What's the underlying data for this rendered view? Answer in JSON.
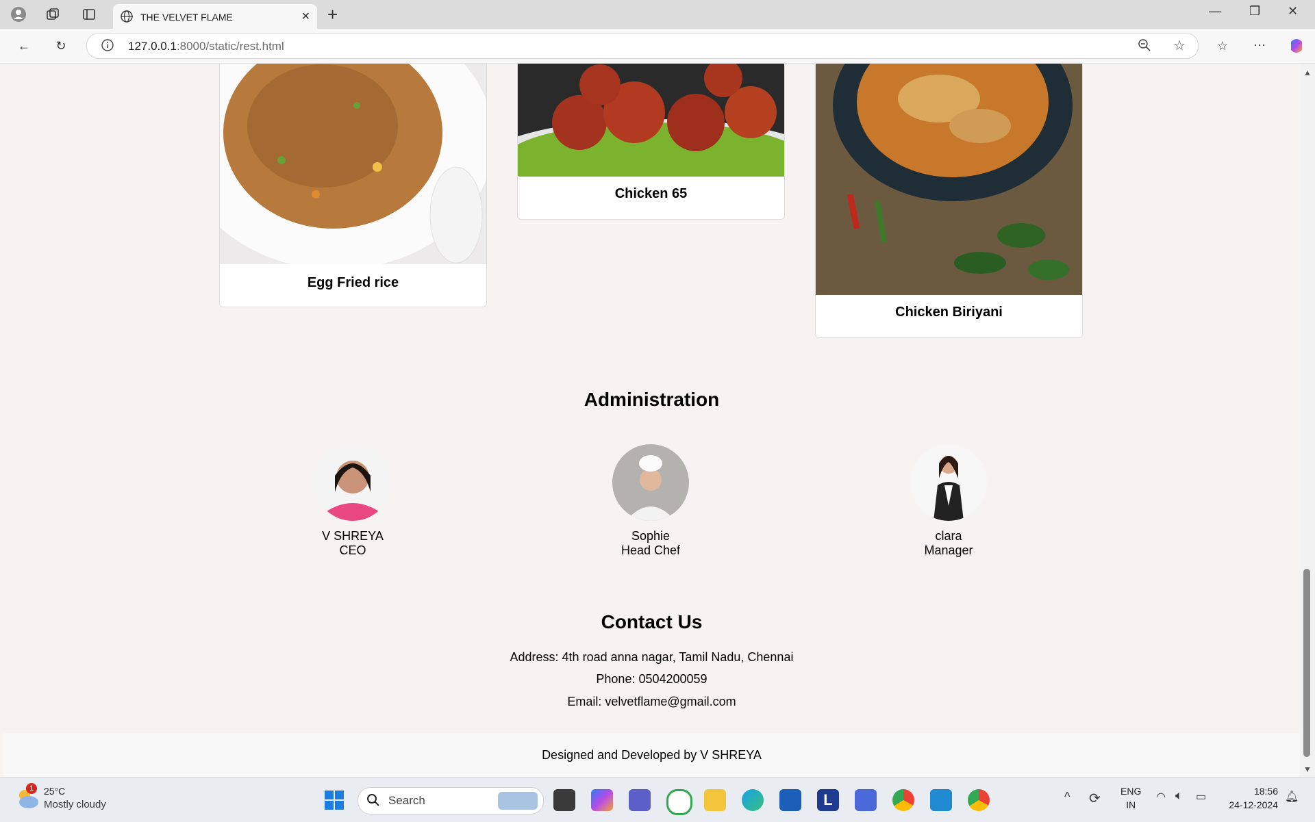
{
  "browser": {
    "tab_title": "THE VELVET FLAME",
    "url_host": "127.0.0.1",
    "url_rest": ":8000/static/rest.html"
  },
  "dishes": [
    {
      "name": "Egg Fried rice"
    },
    {
      "name": "Chicken 65"
    },
    {
      "name": "Chicken Biriyani"
    }
  ],
  "administration": {
    "title": "Administration",
    "members": [
      {
        "name": "V SHREYA",
        "role": "CEO"
      },
      {
        "name": "Sophie",
        "role": "Head Chef"
      },
      {
        "name": "clara",
        "role": "Manager"
      }
    ]
  },
  "contact": {
    "title": "Contact Us",
    "address": "Address: 4th road anna nagar, Tamil Nadu, Chennai",
    "phone": "Phone: 0504200059",
    "email": "Email: velvetflame@gmail.com"
  },
  "footer": {
    "text": "Designed and Developed by V SHREYA"
  },
  "taskbar": {
    "weather_badge": "1",
    "temperature": "25°C",
    "weather": "Mostly cloudy",
    "search_label": "Search",
    "lang_top": "ENG",
    "lang_bottom": "IN",
    "time": "18:56",
    "date": "24-12-2024"
  }
}
